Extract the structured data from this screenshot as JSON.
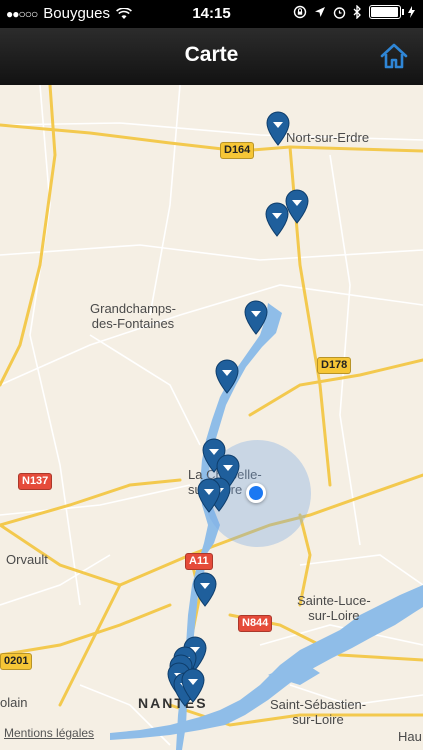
{
  "status_bar": {
    "signal_dots": "●●○○○",
    "carrier": "Bouygues",
    "time": "14:15"
  },
  "navbar": {
    "title": "Carte",
    "home_icon": "home-icon"
  },
  "map": {
    "place_labels": {
      "nort": "Nort-sur-Erdre",
      "grandchamps": "Grandchamps-\ndes-Fontaines",
      "chapelle": "La Chapelle-\nsur-Erdre",
      "orvault": "Orvault",
      "sainte_luce": "Sainte-Luce-\nsur-Loire",
      "saint_sebastien": "Saint-Sébastien-\nsur-Loire",
      "nantes": "NANTES",
      "haute": "Hau",
      "blain": "olain"
    },
    "road_labels": {
      "d164": "D164",
      "d178": "D178",
      "n137": "N137",
      "a11": "A11",
      "n844": "N844",
      "d201": "0201"
    },
    "legal": "Mentions légales",
    "colors": {
      "pin": "#1f5f9c",
      "water": "#8fbde8",
      "user_location": "#1b78f2"
    }
  }
}
